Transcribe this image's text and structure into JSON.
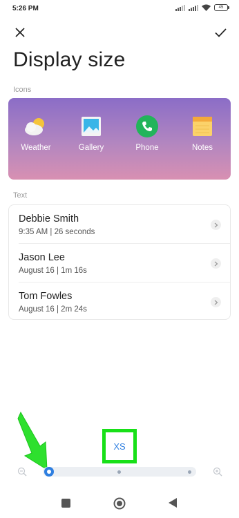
{
  "status_bar": {
    "time": "5:26 PM",
    "battery": "45"
  },
  "header": {
    "title": "Display size"
  },
  "icons_section": {
    "label": "Icons",
    "apps": [
      {
        "label": "Weather",
        "icon": "weather-icon"
      },
      {
        "label": "Gallery",
        "icon": "gallery-icon"
      },
      {
        "label": "Phone",
        "icon": "phone-icon"
      },
      {
        "label": "Notes",
        "icon": "notes-icon"
      }
    ]
  },
  "text_section": {
    "label": "Text",
    "items": [
      {
        "name": "Debbie Smith",
        "detail": "9:35 AM | 26 seconds"
      },
      {
        "name": "Jason Lee",
        "detail": "August 16 | 1m 16s"
      },
      {
        "name": "Tom Fowles",
        "detail": "August 16 | 2m 24s"
      }
    ]
  },
  "size_selector": {
    "current_size": "XS",
    "level": 0,
    "levels_total": 3
  },
  "colors": {
    "accent": "#2f7fe0",
    "highlight": "#18e018",
    "card_gradient_top": "#8b6dc7",
    "card_gradient_bottom": "#d890b2"
  }
}
